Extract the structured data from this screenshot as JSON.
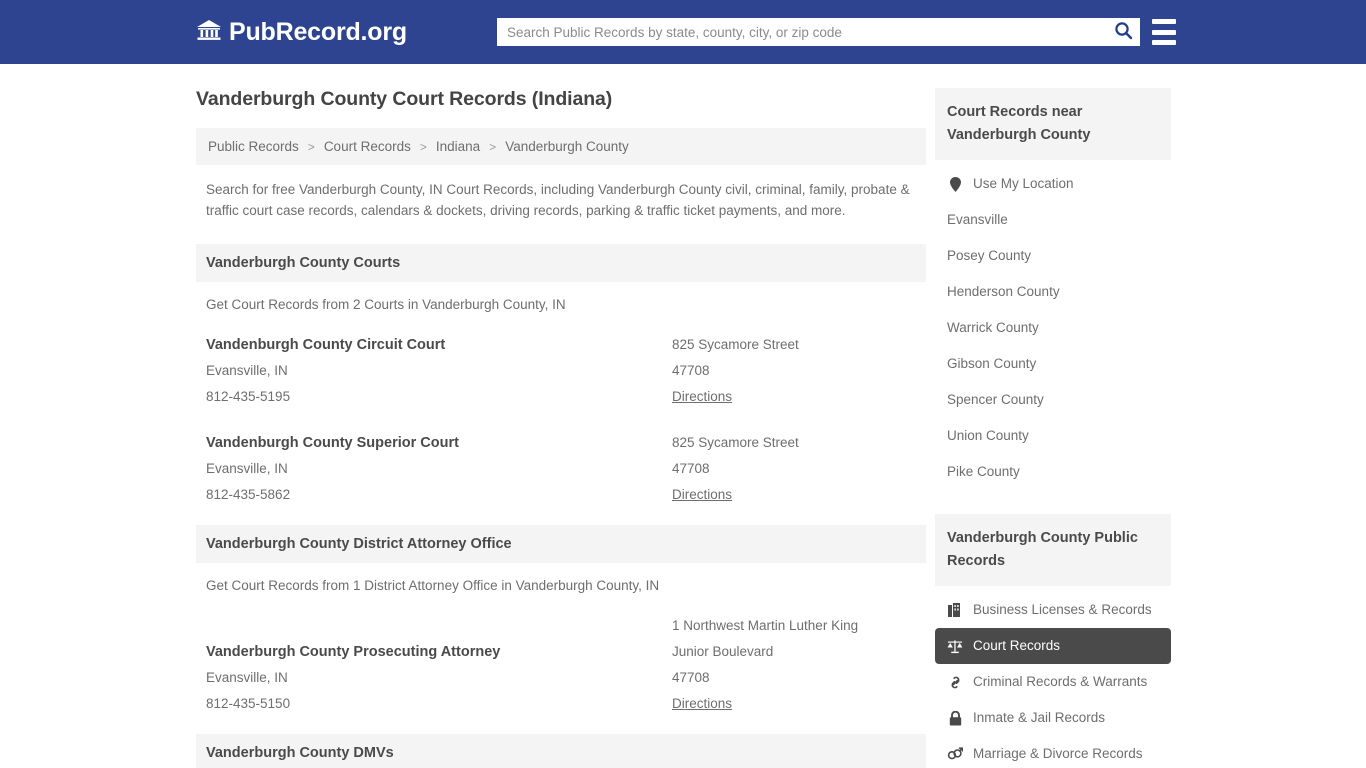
{
  "header": {
    "brand_name": "PubRecord.org",
    "brand_icon": "bank-building-icon",
    "search_placeholder": "Search Public Records by state, county, city, or zip code",
    "search_value": "",
    "search_icon": "search-icon",
    "menu_icon": "hamburger-menu-icon"
  },
  "main": {
    "page_title": "Vanderburgh County Court Records (Indiana)",
    "breadcrumb": [
      {
        "label": "Public Records"
      },
      {
        "label": "Court Records"
      },
      {
        "label": "Indiana"
      },
      {
        "label": "Vanderburgh County"
      }
    ],
    "breadcrumb_separator": ">",
    "intro": "Search for free Vanderburgh County, IN Court Records, including Vanderburgh County civil, criminal, family, probate & traffic court case records, calendars & dockets, driving records, parking & traffic ticket payments, and more.",
    "sections": [
      {
        "heading": "Vanderburgh County Courts",
        "subtitle": "Get Court Records from 2 Courts in Vanderburgh County, IN",
        "entries": [
          {
            "name": "Vandenburgh County Circuit Court",
            "city_state": "Evansville, IN",
            "phone": "812-435-5195",
            "address": "825 Sycamore Street",
            "zip": "47708",
            "directions_label": "Directions"
          },
          {
            "name": "Vandenburgh County Superior Court",
            "city_state": "Evansville, IN",
            "phone": "812-435-5862",
            "address": "825 Sycamore Street",
            "zip": "47708",
            "directions_label": "Directions"
          }
        ]
      },
      {
        "heading": "Vanderburgh County District Attorney Office",
        "subtitle": "Get Court Records from 1 District Attorney Office in Vanderburgh County, IN",
        "entries": [
          {
            "name": "Vanderburgh County Prosecuting Attorney",
            "city_state": "Evansville, IN",
            "phone": "812-435-5150",
            "address": "1 Northwest Martin Luther King",
            "address2": "Junior Boulevard",
            "zip": "47708",
            "directions_label": "Directions"
          }
        ]
      },
      {
        "heading": "Vanderburgh County DMVs",
        "subtitle": "",
        "entries": []
      }
    ]
  },
  "sidebar": {
    "nearby": {
      "heading": "Court Records near Vanderburgh County",
      "items": [
        {
          "label": "Use My Location",
          "icon": "map-pin-icon"
        },
        {
          "label": "Evansville",
          "icon": ""
        },
        {
          "label": "Posey County",
          "icon": ""
        },
        {
          "label": "Henderson County",
          "icon": ""
        },
        {
          "label": "Warrick County",
          "icon": ""
        },
        {
          "label": "Gibson County",
          "icon": ""
        },
        {
          "label": "Spencer County",
          "icon": ""
        },
        {
          "label": "Union County",
          "icon": ""
        },
        {
          "label": "Pike County",
          "icon": ""
        }
      ]
    },
    "public_records": {
      "heading": "Vanderburgh County Public Records",
      "items": [
        {
          "label": "Business Licenses & Records",
          "icon": "briefcase-icon",
          "active": false
        },
        {
          "label": "Court Records",
          "icon": "scales-of-justice-icon",
          "active": true
        },
        {
          "label": "Criminal Records & Warrants",
          "icon": "chain-link-icon",
          "active": false
        },
        {
          "label": "Inmate & Jail Records",
          "icon": "padlock-icon",
          "active": false
        },
        {
          "label": "Marriage & Divorce Records",
          "icon": "gender-symbols-icon",
          "active": false
        }
      ]
    }
  },
  "colors": {
    "header_blue": "#2e4490",
    "section_gray": "#f4f4f4",
    "active_dark": "#4a4a4a",
    "text_gray": "#6e6e6e"
  }
}
